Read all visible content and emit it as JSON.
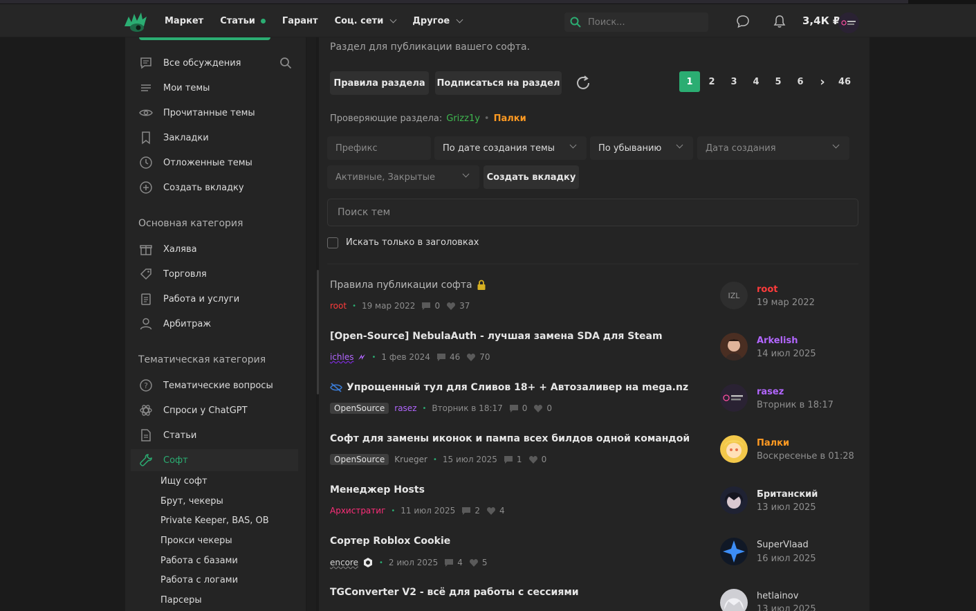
{
  "header": {
    "nav": [
      {
        "label": "Маркет"
      },
      {
        "label": "Статьи"
      },
      {
        "label": "Гарант"
      },
      {
        "label": "Соц. сети"
      },
      {
        "label": "Другое"
      }
    ],
    "search_placeholder": "Поиск...",
    "balance": "3,4К ₽"
  },
  "sidebar": {
    "top_items": [
      {
        "label": "Все обсуждения",
        "icon": "chat-bubble-icon"
      },
      {
        "label": "Мои темы",
        "icon": "list-icon"
      },
      {
        "label": "Прочитанные темы",
        "icon": "eye-icon"
      },
      {
        "label": "Закладки",
        "icon": "bookmark-icon"
      },
      {
        "label": "Отложенные темы",
        "icon": "clock-icon"
      },
      {
        "label": "Создать вкладку",
        "icon": "plus-circle-icon"
      }
    ],
    "main_heading": "Основная категория",
    "main_items": [
      {
        "label": "Халява",
        "icon": "gift-icon"
      },
      {
        "label": "Торговля",
        "icon": "tag-icon"
      },
      {
        "label": "Работа и услуги",
        "icon": "clipboard-icon"
      },
      {
        "label": "Арбитраж",
        "icon": "user-icon"
      }
    ],
    "theme_heading": "Тематическая категория",
    "theme_items": [
      {
        "label": "Тематические вопросы",
        "icon": "question-icon"
      },
      {
        "label": "Спроси у ChatGPT",
        "icon": "openai-icon"
      },
      {
        "label": "Статьи",
        "icon": "document-icon"
      },
      {
        "label": "Софт",
        "icon": "wrench-icon"
      }
    ],
    "sub_items": [
      "Ищу софт",
      "Брут, чекеры",
      "Private Keeper, BAS, OB",
      "Прокси чекеры",
      "Работа с базами",
      "Работа с логами",
      "Парсеры"
    ]
  },
  "main": {
    "description": "Раздел для публикации вашего софта.",
    "rules_button": "Правила раздела",
    "subscribe_button": "Подписаться на раздел",
    "pages": [
      "1",
      "2",
      "3",
      "4",
      "5",
      "6",
      "›",
      "46"
    ],
    "checkers_label": "Проверяющие раздела:",
    "checker_1": "Grizz1y",
    "checker_2": "Палки",
    "filters": {
      "prefix": "Префикс",
      "sort": "По дате создания темы",
      "order": "По убыванию",
      "date": "Дата создания",
      "state": "Активные, Закрытые",
      "create_tab": "Создать вкладку"
    },
    "thread_search_placeholder": "Поиск тем",
    "titles_only": "Искать только в заголовках"
  },
  "threads": [
    {
      "title": "Правила публикации софта",
      "tag": "",
      "author": "root",
      "date": "19 мар 2022",
      "replies": "0",
      "likes": "37",
      "last_user": "root",
      "last_date": "19 мар 2022"
    },
    {
      "title": "[Open-Source] NebulaAuth - лучшая замена SDA для Steam",
      "tag": "",
      "author": "ichles",
      "date": "1 фев 2024",
      "replies": "46",
      "likes": "70",
      "last_user": "Arkelish",
      "last_date": "14 июл 2025"
    },
    {
      "title": "Упрощенный тул для Сливов 18+ + Автозаливер на mega.nz",
      "tag": "OpenSource",
      "author": "rasez",
      "date": "Вторник в 18:17",
      "replies": "0",
      "likes": "0",
      "last_user": "rasez",
      "last_date": "Вторник в 18:17"
    },
    {
      "title": "Софт для замены иконок и пампа всех билдов одной командой",
      "tag": "OpenSource",
      "author": "Krueger",
      "date": "15 июл 2025",
      "replies": "1",
      "likes": "0",
      "last_user": "Палки",
      "last_date": "Воскресенье в 01:28"
    },
    {
      "title": "Менеджер Hosts",
      "tag": "",
      "author": "Архистратиг",
      "date": "11 июл 2025",
      "replies": "2",
      "likes": "4",
      "last_user": "Британский",
      "last_date": "13 июл 2025"
    },
    {
      "title": "Сортер Roblox Cookie",
      "tag": "",
      "author": "encore",
      "date": "2 июл 2025",
      "replies": "4",
      "likes": "5",
      "last_user": "SuperVlaad",
      "last_date": "16 июл 2025"
    },
    {
      "title": "TGConverter V2 - всё для работы с сессиями",
      "tag": "",
      "author": "",
      "date": "",
      "replies": "",
      "likes": "",
      "last_user": "hetlainov",
      "last_date": "13 июл 2025"
    }
  ],
  "colors": {
    "accent": "#2bad72",
    "orange": "#ff9a22",
    "red": "#ff3b3b",
    "purple": "#b266ff",
    "pink": "#ff2e7a"
  }
}
